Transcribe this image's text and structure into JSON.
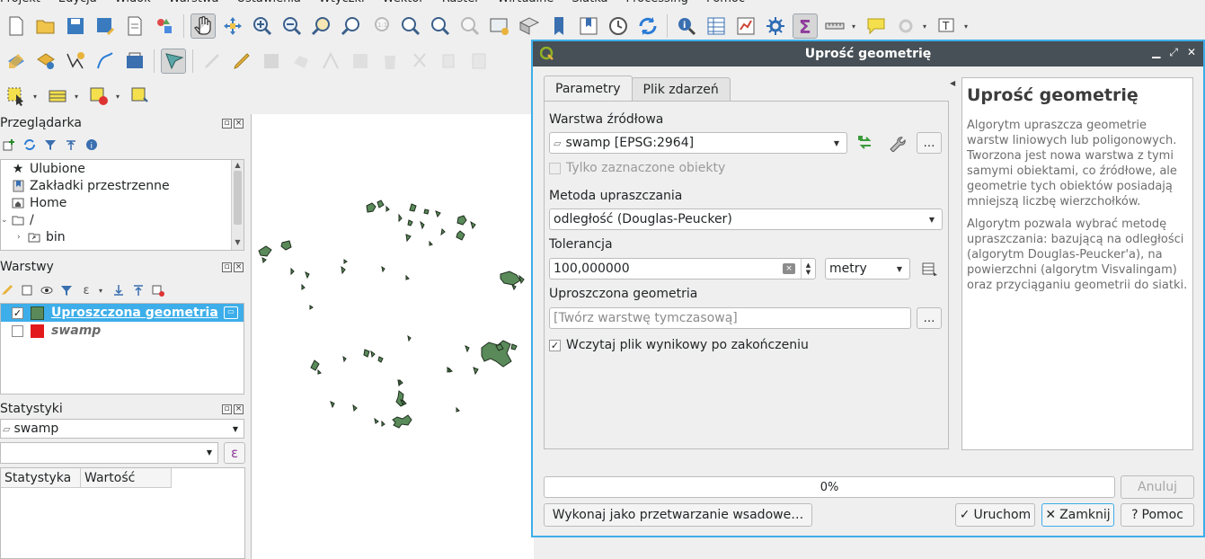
{
  "menubar": {
    "items": [
      "Projekt",
      "Edycja",
      "Widok",
      "Warstwa",
      "Ustawienia",
      "Wtyczki",
      "Wektor",
      "Raster",
      "Wirtualne",
      "Siatka",
      "Processing",
      "Pomoc"
    ]
  },
  "browser_panel": {
    "title": "Przeglądarka",
    "items": [
      {
        "label": "Ulubione",
        "icon": "star-icon"
      },
      {
        "label": "Zakładki przestrzenne",
        "icon": "bookmark-icon"
      },
      {
        "label": "Home",
        "icon": "home-folder-icon"
      },
      {
        "label": "/",
        "icon": "folder-icon"
      },
      {
        "label": "bin",
        "icon": "folder-link-icon"
      }
    ]
  },
  "layers_panel": {
    "title": "Warstwy",
    "layers": [
      {
        "name": "Uproszczona geometria",
        "checked": true,
        "color": "#5a8a5a",
        "selected": true
      },
      {
        "name": "swamp",
        "checked": false,
        "color": "#e31a1c",
        "selected": false
      }
    ]
  },
  "stats_panel": {
    "title": "Statystyki",
    "layer": "swamp",
    "col_stat": "Statystyka",
    "col_value": "Wartość",
    "expr_icon": "ε"
  },
  "dialog": {
    "title": "Uprość geometrię",
    "tabs": [
      "Parametry",
      "Plik zdarzeń"
    ],
    "source_label": "Warstwa źródłowa",
    "source_value": "swamp [EPSG:2964]",
    "selected_only_label": "Tylko zaznaczone obiekty",
    "method_label": "Metoda upraszczania",
    "method_value": "odległość (Douglas-Peucker)",
    "tolerance_label": "Tolerancja",
    "tolerance_value": "100,000000",
    "unit_value": "metry",
    "output_label": "Uproszczona geometria",
    "output_placeholder": "[Twórz warstwę tymczasową]",
    "load_result_label": "Wczytaj plik wynikowy po zakończeniu",
    "ellipsis": "…",
    "help_title": "Uprość geometrię",
    "help_p1": "Algorytm upraszcza geometrie warstw liniowych lub poligonowych. Tworzona jest nowa warstwa z tymi samymi obiektami, co źródłowe, ale geometrie tych obiektów posiadają mniejszą liczbę wierzchołków.",
    "help_p2": "Algorytm pozwala wybrać metodę upraszczania: bazującą na odległości (algorytm Douglas-Peucker'a), na powierzchni (algorytm Visvalingam) oraz przyciąganiu geometrii do siatki.",
    "progress": "0%",
    "cancel_label": "Anuluj",
    "batch_label": "Wykonaj jako przetwarzanie wsadowe…",
    "run_label": "Uruchom",
    "close_label": "Zamknij",
    "help_label": "Pomoc"
  },
  "colors": {
    "accent": "#3daee9",
    "titlebar": "#475057",
    "polygon_fill": "#5a8a5a",
    "swamp": "#e31a1c"
  }
}
